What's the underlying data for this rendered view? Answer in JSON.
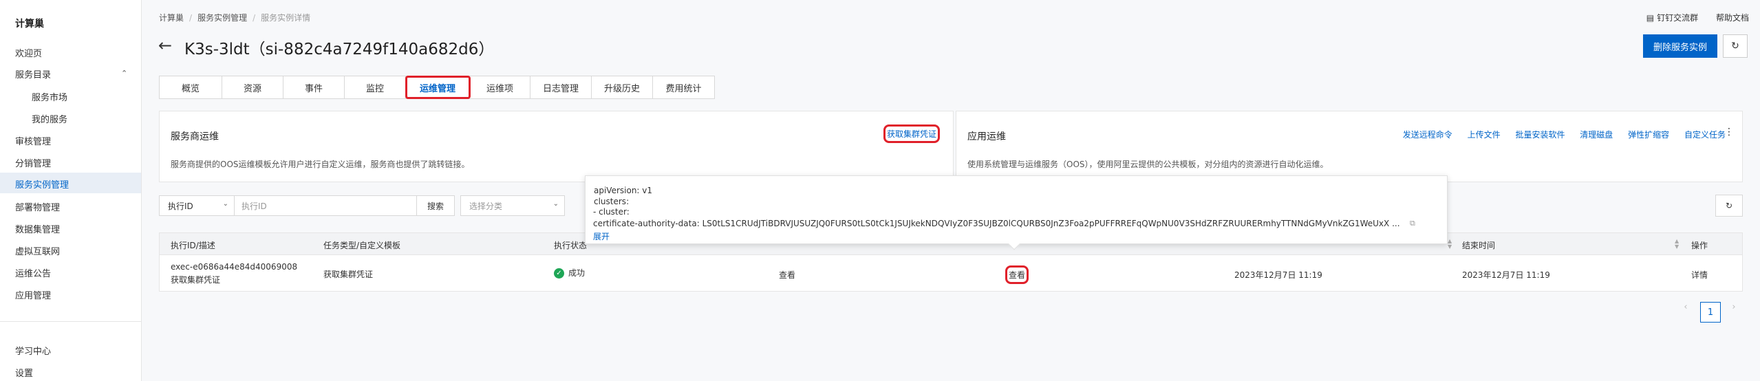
{
  "sidebar": {
    "title": "计算巢",
    "items": [
      {
        "label": "欢迎页"
      },
      {
        "label": "服务目录"
      },
      {
        "label": "服务市场"
      },
      {
        "label": "我的服务"
      },
      {
        "label": "审核管理"
      },
      {
        "label": "分销管理"
      },
      {
        "label": "服务实例管理"
      },
      {
        "label": "部署物管理"
      },
      {
        "label": "数据集管理"
      },
      {
        "label": "虚拟互联网"
      },
      {
        "label": "运维公告"
      },
      {
        "label": "应用管理"
      },
      {
        "label": "学习中心"
      },
      {
        "label": "设置"
      }
    ]
  },
  "breadcrumb": [
    "计算巢",
    "服务实例管理",
    "服务实例详情"
  ],
  "top_right": {
    "dingtalk": "钉钉交流群",
    "help": "帮助文档"
  },
  "page": {
    "title": "K3s-3ldt（si-882c4a7249f140a682d6）",
    "delete_button": "删除服务实例"
  },
  "tabs": [
    "概览",
    "资源",
    "事件",
    "监控",
    "运维管理",
    "运维项",
    "日志管理",
    "升级历史",
    "费用统计"
  ],
  "provider_ops": {
    "title": "服务商运维",
    "link": "获取集群凭证",
    "desc": "服务商提供的OOS运维模板允许用户进行自定义运维，服务商也提供了跳转链接。"
  },
  "app_ops": {
    "title": "应用运维",
    "actions": [
      "发送远程命令",
      "上传文件",
      "批量安装软件",
      "清理磁盘",
      "弹性扩缩容",
      "自定义任务"
    ],
    "desc": "使用系统管理与运维服务（OOS），使用阿里云提供的公共模板，对分组内的资源进行自动化运维。"
  },
  "filters": {
    "select_value": "执行ID",
    "input_placeholder": "执行ID",
    "search_button": "搜索",
    "category_placeholder": "选择分类"
  },
  "table": {
    "headers": [
      "执行ID/描述",
      "任务类型/自定义模板",
      "执行状态",
      "结束时间",
      "操作"
    ],
    "rows": [
      {
        "exec_id": "exec-e0686a44e84d40069008",
        "desc": "获取集群凭证",
        "task_type": "获取集群凭证",
        "status": "成功",
        "view1": "查看",
        "view2": "查看",
        "start_time": "2023年12月7日 11:19",
        "end_time": "2023年12月7日 11:19",
        "detail": "详情"
      }
    ]
  },
  "popover": {
    "lines": [
      "apiVersion: v1",
      "clusters:",
      "- cluster:",
      "    certificate-authority-data: LS0tLS1CRUdJTiBDRVJUSUZJQ0FURS0tLS0tCk1JSUJkekNDQVIyZ0F3SUJBZ0lCQURBS0JnZ3Foa2pPUFFRREFqQWpNU0V3SHdZRFZRUURERmhyTTNNdGMyVnkZG1WeUxX ..."
    ],
    "expand": "展开"
  },
  "pagination": {
    "current": "1"
  }
}
